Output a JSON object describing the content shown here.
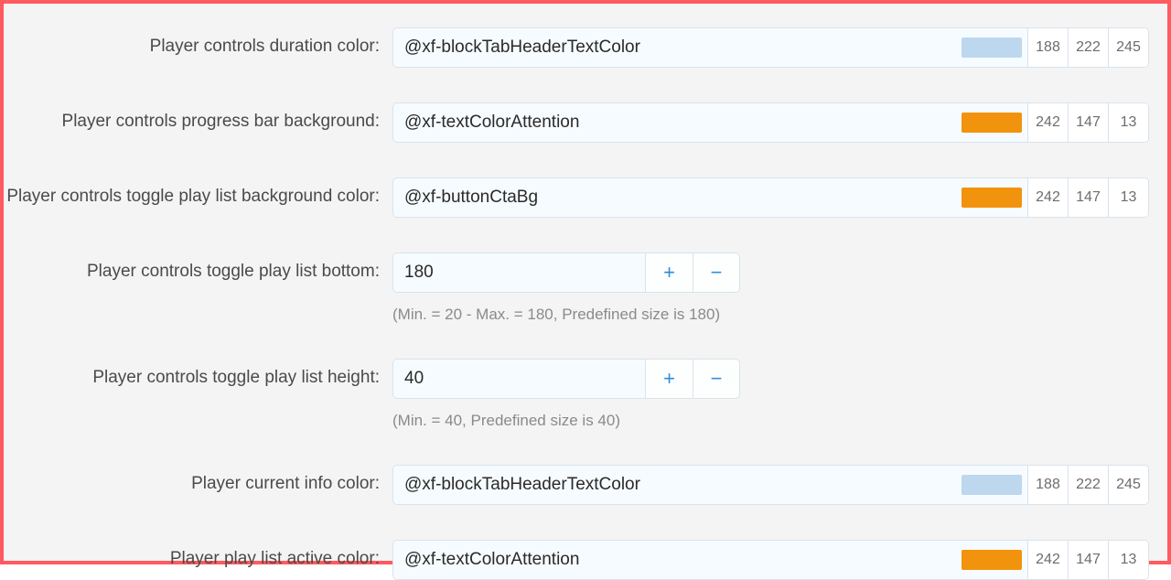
{
  "rows": [
    {
      "type": "color",
      "label": "Player controls duration color:",
      "value": "@xf-blockTabHeaderTextColor",
      "swatch": "#bdd7ee",
      "r": "188",
      "g": "222",
      "b": "245"
    },
    {
      "type": "color",
      "label": "Player controls progress bar background:",
      "value": "@xf-textColorAttention",
      "swatch": "#f2930d",
      "r": "242",
      "g": "147",
      "b": "13"
    },
    {
      "type": "color",
      "label": "Player controls toggle play list background color:",
      "value": "@xf-buttonCtaBg",
      "swatch": "#f2930d",
      "r": "242",
      "g": "147",
      "b": "13"
    },
    {
      "type": "number",
      "label": "Player controls toggle play list bottom:",
      "value": "180",
      "hint": "(Min. = 20 - Max. = 180, Predefined size is 180)"
    },
    {
      "type": "number",
      "label": "Player controls toggle play list height:",
      "value": "40",
      "hint": "(Min. = 40, Predefined size is 40)"
    },
    {
      "type": "color",
      "label": "Player current info color:",
      "value": "@xf-blockTabHeaderTextColor",
      "swatch": "#bdd7ee",
      "r": "188",
      "g": "222",
      "b": "245"
    },
    {
      "type": "color",
      "label": "Player play list active color:",
      "value": "@xf-textColorAttention",
      "swatch": "#f2930d",
      "r": "242",
      "g": "147",
      "b": "13"
    }
  ],
  "icons": {
    "plus": "+",
    "minus": "−"
  }
}
